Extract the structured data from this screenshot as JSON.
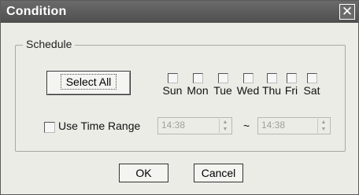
{
  "window": {
    "title": "Condition",
    "close_glyph": "✕"
  },
  "schedule": {
    "group_label": "Schedule",
    "select_all_label": "Select All",
    "days": [
      "Sun",
      "Mon",
      "Tue",
      "Wed",
      "Thu",
      "Fri",
      "Sat"
    ],
    "use_time_range_label": "Use Time Range",
    "start_time": "14:38",
    "range_separator": "~",
    "end_time": "14:38"
  },
  "footer": {
    "ok_label": "OK",
    "cancel_label": "Cancel"
  },
  "colors": {
    "titlebar": "#5c5c5c",
    "dialog_bg": "#ecece7",
    "disabled_text": "#a0a09b"
  }
}
